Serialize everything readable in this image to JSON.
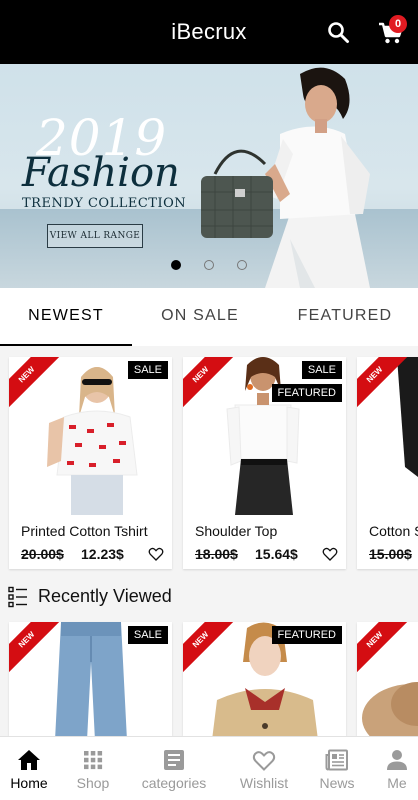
{
  "appbar": {
    "title": "iBecrux",
    "cart_count": "0",
    "search_icon": "search-icon",
    "cart_icon": "cart-icon"
  },
  "banner": {
    "year": "2019",
    "headline": "Fashion",
    "subtitle": "TRENDY COLLECTION",
    "cta": "VIEW ALL RANGE",
    "slides": 3,
    "active_slide": 1
  },
  "tabs": [
    {
      "label": "NEWEST",
      "active": true
    },
    {
      "label": "ON SALE",
      "active": false
    },
    {
      "label": "FEATURED",
      "active": false
    }
  ],
  "products": [
    {
      "ribbon": "NEW",
      "badges": [
        "SALE"
      ],
      "name": "Printed Cotton Tshirt",
      "old_price": "20.00$",
      "price": "12.23$"
    },
    {
      "ribbon": "NEW",
      "badges": [
        "SALE",
        "FEATURED"
      ],
      "name": "Shoulder Top",
      "old_price": "18.00$",
      "price": "15.64$"
    },
    {
      "ribbon": "NEW",
      "badges": [],
      "name": "Cotton S",
      "old_price": "15.00$",
      "price": ""
    }
  ],
  "recently_viewed": {
    "title": "Recently Viewed",
    "items": [
      {
        "ribbon": "NEW",
        "badges": [
          "SALE"
        ]
      },
      {
        "ribbon": "NEW",
        "badges": [
          "FEATURED"
        ]
      },
      {
        "ribbon": "NEW",
        "badges": []
      }
    ]
  },
  "bottom_nav": [
    {
      "label": "Home",
      "icon": "home-icon",
      "active": true
    },
    {
      "label": "Shop",
      "icon": "grid-icon",
      "active": false
    },
    {
      "label": "categories",
      "icon": "list-box-icon",
      "active": false
    },
    {
      "label": "Wishlist",
      "icon": "heart-icon",
      "active": false
    },
    {
      "label": "News",
      "icon": "newspaper-icon",
      "active": false
    },
    {
      "label": "Me",
      "icon": "person-icon",
      "active": false
    }
  ],
  "colors": {
    "accent": "#000000",
    "badge": "#e11b22",
    "ribbon": "#d40d12",
    "inactive": "#9a9a9a"
  }
}
